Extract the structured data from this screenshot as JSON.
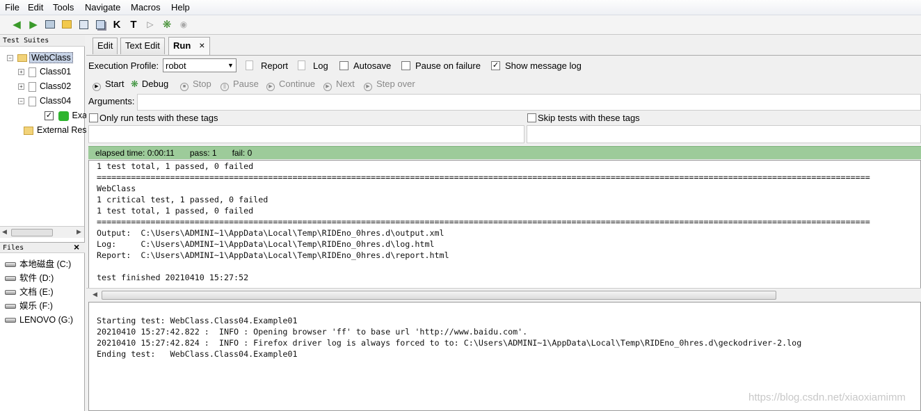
{
  "menu": [
    "File",
    "Edit",
    "Tools",
    "Navigate",
    "Macros",
    "Help"
  ],
  "toolbar_icons": [
    "back-arrow-icon",
    "forward-arrow-icon",
    "open-file-icon",
    "open-directory-icon",
    "save-icon",
    "save-all-icon",
    "search-keywords-icon",
    "search-tests-icon",
    "run-icon",
    "debug-icon",
    "stop-icon"
  ],
  "toolbar_glyphs": {
    "keyword": "K",
    "test": "T"
  },
  "test_suites": {
    "title": "Test Suites",
    "root": "WebClass",
    "children": [
      "Class01",
      "Class02",
      "Class04"
    ],
    "test": "Exa",
    "external": "External Res"
  },
  "files": {
    "title": "Files",
    "drives": [
      "本地磁盘 (C:)",
      "软件 (D:)",
      "文档 (E:)",
      "娱乐 (F:)",
      "LENOVO (G:)"
    ]
  },
  "tabs": [
    "Edit",
    "Text Edit",
    "Run"
  ],
  "tab_close": "×",
  "run": {
    "profile_label": "Execution Profile:",
    "profile_value": "robot",
    "report_label": "Report",
    "log_label": "Log",
    "autosave_label": "Autosave",
    "pause_label": "Pause on failure",
    "show_log_label": "Show message log",
    "controls": [
      "Start",
      "Debug",
      "Stop",
      "Pause",
      "Continue",
      "Next",
      "Step over"
    ],
    "arguments_label": "Arguments:",
    "only_run_label": "Only run tests with these tags",
    "skip_label": "Skip tests with these tags"
  },
  "status": {
    "elapsed": "elapsed time: 0:00:11",
    "pass": "pass: 1",
    "fail": "fail: 0"
  },
  "output_lines": [
    "1 test total, 1 passed, 0 failed",
    "==============================================================================================================================================================",
    "WebClass",
    "1 critical test, 1 passed, 0 failed",
    "1 test total, 1 passed, 0 failed",
    "==============================================================================================================================================================",
    "Output:  C:\\Users\\ADMINI~1\\AppData\\Local\\Temp\\RIDEno_0hres.d\\output.xml",
    "Log:     C:\\Users\\ADMINI~1\\AppData\\Local\\Temp\\RIDEno_0hres.d\\log.html",
    "Report:  C:\\Users\\ADMINI~1\\AppData\\Local\\Temp\\RIDEno_0hres.d\\report.html",
    "",
    "test finished 20210410 15:27:52"
  ],
  "message_log": [
    "Starting test: WebClass.Class04.Example01",
    "20210410 15:27:42.822 :  INFO : Opening browser 'ff' to base url 'http://www.baidu.com'.",
    "20210410 15:27:42.824 :  INFO : Firefox driver log is always forced to to: C:\\Users\\ADMINI~1\\AppData\\Local\\Temp\\RIDEno_0hres.d\\geckodriver-2.log",
    "Ending test:   WebClass.Class04.Example01"
  ],
  "watermark": "https://blog.csdn.net/xiaoxiamimm",
  "colors": {
    "status_green": "#9dcb9a",
    "selection": "#c7d3e6"
  }
}
